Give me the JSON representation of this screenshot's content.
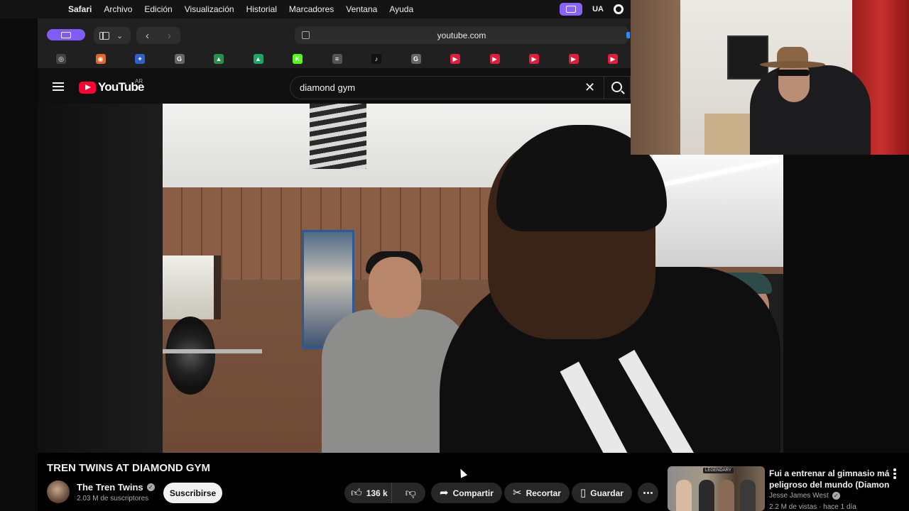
{
  "menubar": {
    "items": [
      "Safari",
      "Archivo",
      "Edición",
      "Visualización",
      "Historial",
      "Marcadores",
      "Ventana",
      "Ayuda"
    ],
    "status_text": "UA"
  },
  "browser": {
    "url": "youtube.com",
    "favorites": [
      {
        "icon": "chatgpt-icon",
        "color": "#444444",
        "glyph": "◎"
      },
      {
        "icon": "orange-app-icon",
        "color": "#e0662b",
        "glyph": "◉"
      },
      {
        "icon": "gemini-icon",
        "color": "#2f62c9",
        "glyph": "✦"
      },
      {
        "icon": "grammarly-icon",
        "color": "#666666",
        "glyph": "G"
      },
      {
        "icon": "flag-icon",
        "color": "#2a8f4a",
        "glyph": "▲"
      },
      {
        "icon": "google-drive-icon",
        "color": "#1fa463",
        "glyph": "▲"
      },
      {
        "icon": "kick-icon",
        "color": "#53fc18",
        "glyph": "K"
      },
      {
        "icon": "notes-icon",
        "color": "#555555",
        "glyph": "≡"
      },
      {
        "icon": "tiktok-icon",
        "color": "#111111",
        "glyph": "♪"
      },
      {
        "icon": "grammarly-icon",
        "color": "#666666",
        "glyph": "G"
      },
      {
        "icon": "youtube-icon",
        "color": "#e01e3c",
        "glyph": "▶"
      },
      {
        "icon": "youtube-icon",
        "color": "#e01e3c",
        "glyph": "▶"
      },
      {
        "icon": "youtube-icon",
        "color": "#e01e3c",
        "glyph": "▶"
      },
      {
        "icon": "youtube-icon",
        "color": "#e01e3c",
        "glyph": "▶"
      },
      {
        "icon": "youtube-icon",
        "color": "#e01e3c",
        "glyph": "▶"
      }
    ]
  },
  "youtube": {
    "logo_text": "YouTube",
    "country_code": "AR",
    "search_query": "diamond gym",
    "video": {
      "title": "TREN TWINS AT DIAMOND GYM",
      "channel": "The Tren Twins",
      "subscribers": "2.03 M de suscriptores",
      "subscribe_label": "Suscribirse",
      "likes": "136 k",
      "share_label": "Compartir",
      "clip_label": "Recortar",
      "save_label": "Guardar"
    },
    "recommendation": {
      "title_line1": "Fui a entrenar al gimnasio más",
      "title_line2": "peligroso del mundo (Diamon...",
      "channel": "Jesse James West",
      "meta": "2.2 M de vistas · hace 1 día",
      "thumb_badge": "LEGENDARY"
    }
  },
  "colors": {
    "youtube_red": "#ff0033",
    "accent_purple": "#8a63ff",
    "bg": "#0f0f0f"
  }
}
